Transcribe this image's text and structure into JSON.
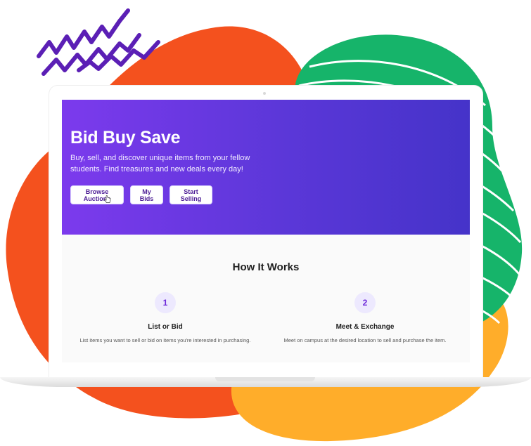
{
  "hero": {
    "title": "Bid Buy Save",
    "description": "Buy, sell, and discover unique items from your fellow students. Find treasures and new deals every day!",
    "buttons": [
      "Browse Auctions",
      "My Bids",
      "Start Selling"
    ]
  },
  "how_it_works": {
    "title": "How It Works",
    "steps": [
      {
        "number": "1",
        "title": "List or Bid",
        "description": "List items you want to sell or bid on items you're interested in purchasing."
      },
      {
        "number": "2",
        "title": "Meet & Exchange",
        "description": "Meet on campus at the desired location to sell and purchase the item."
      }
    ]
  },
  "colors": {
    "accent_purple": "#7c3aed",
    "hero_gradient_end": "#4533c9",
    "blob_orange": "#f4511e",
    "blob_green": "#16b46a",
    "blob_yellow": "#ffad2a",
    "scribble": "#5b1fb5"
  }
}
